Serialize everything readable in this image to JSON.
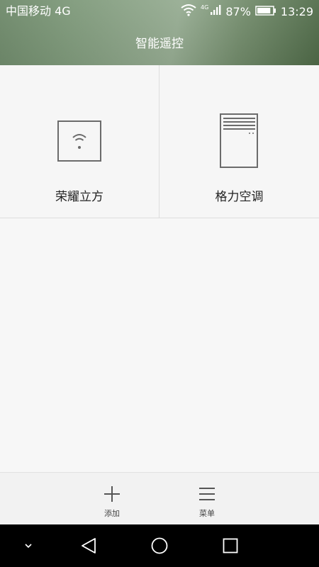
{
  "status_bar": {
    "carrier": "中国移动 4G",
    "network_label": "4G",
    "battery_percent": "87%",
    "battery_level": 0.87,
    "time": "13:29"
  },
  "header": {
    "title": "智能遥控"
  },
  "devices": [
    {
      "name": "荣耀立方",
      "icon": "wifi-box-icon"
    },
    {
      "name": "格力空调",
      "icon": "air-conditioner-icon"
    }
  ],
  "bottom_bar": {
    "add_label": "添加",
    "menu_label": "菜单"
  },
  "nav_bar": {
    "buttons": [
      "chevron-down-icon",
      "back-icon",
      "home-icon",
      "recents-icon"
    ]
  },
  "colors": {
    "header_green": "#7f9a7b",
    "background": "#f6f6f6",
    "bottom_bar": "#f2f2f2",
    "nav_bar": "#000000",
    "icon_gray": "#6b6b6b"
  }
}
